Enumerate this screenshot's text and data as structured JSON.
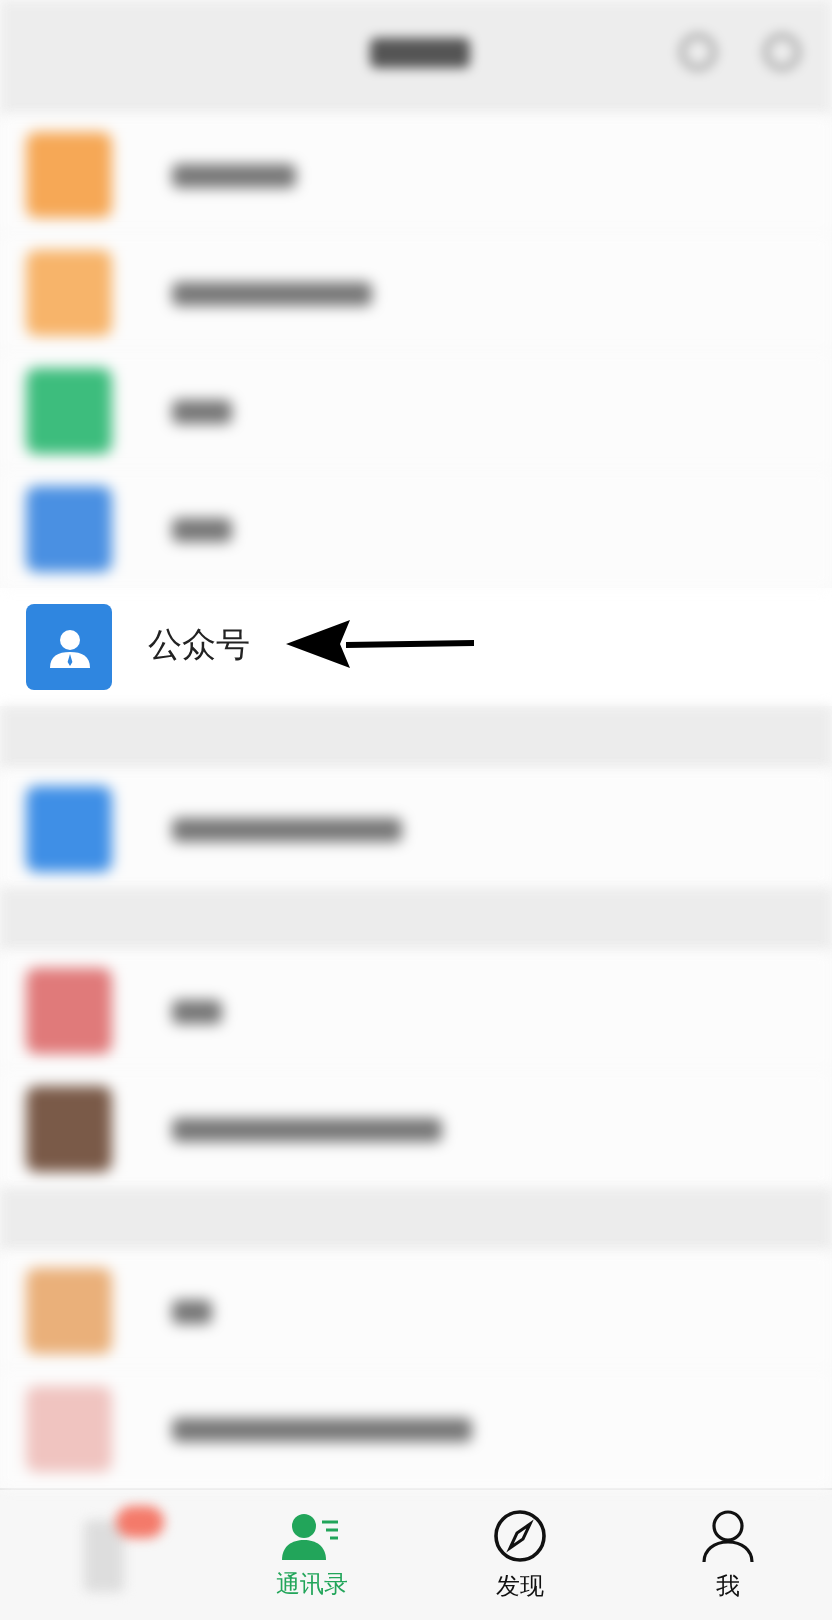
{
  "header": {
    "kind": "blurred"
  },
  "contacts": [
    {
      "kind": "blurred",
      "color": "#f6a856"
    },
    {
      "kind": "blurred",
      "color": "#f7b46a"
    },
    {
      "kind": "blurred",
      "color": "#3dbd7d"
    },
    {
      "kind": "blurred",
      "color": "#4a90e2"
    },
    {
      "kind": "clear",
      "label": "公众号",
      "color": "#2f86e0"
    },
    {
      "kind": "section"
    },
    {
      "kind": "blurred",
      "color": "#3f8fe6"
    },
    {
      "kind": "section"
    },
    {
      "kind": "blurred",
      "color": "#e07a7a"
    },
    {
      "kind": "blurred",
      "color": "#7a5a48"
    },
    {
      "kind": "section"
    },
    {
      "kind": "blurred",
      "color": "#eab07a"
    },
    {
      "kind": "blurred",
      "color": "#f0c4c0"
    }
  ],
  "tabs": [
    {
      "kind": "blurred",
      "selected": false
    },
    {
      "kind": "contacts",
      "label": "通讯录",
      "selected": true
    },
    {
      "kind": "discover",
      "label": "发现",
      "selected": false
    },
    {
      "kind": "me",
      "label": "我",
      "selected": false
    }
  ]
}
